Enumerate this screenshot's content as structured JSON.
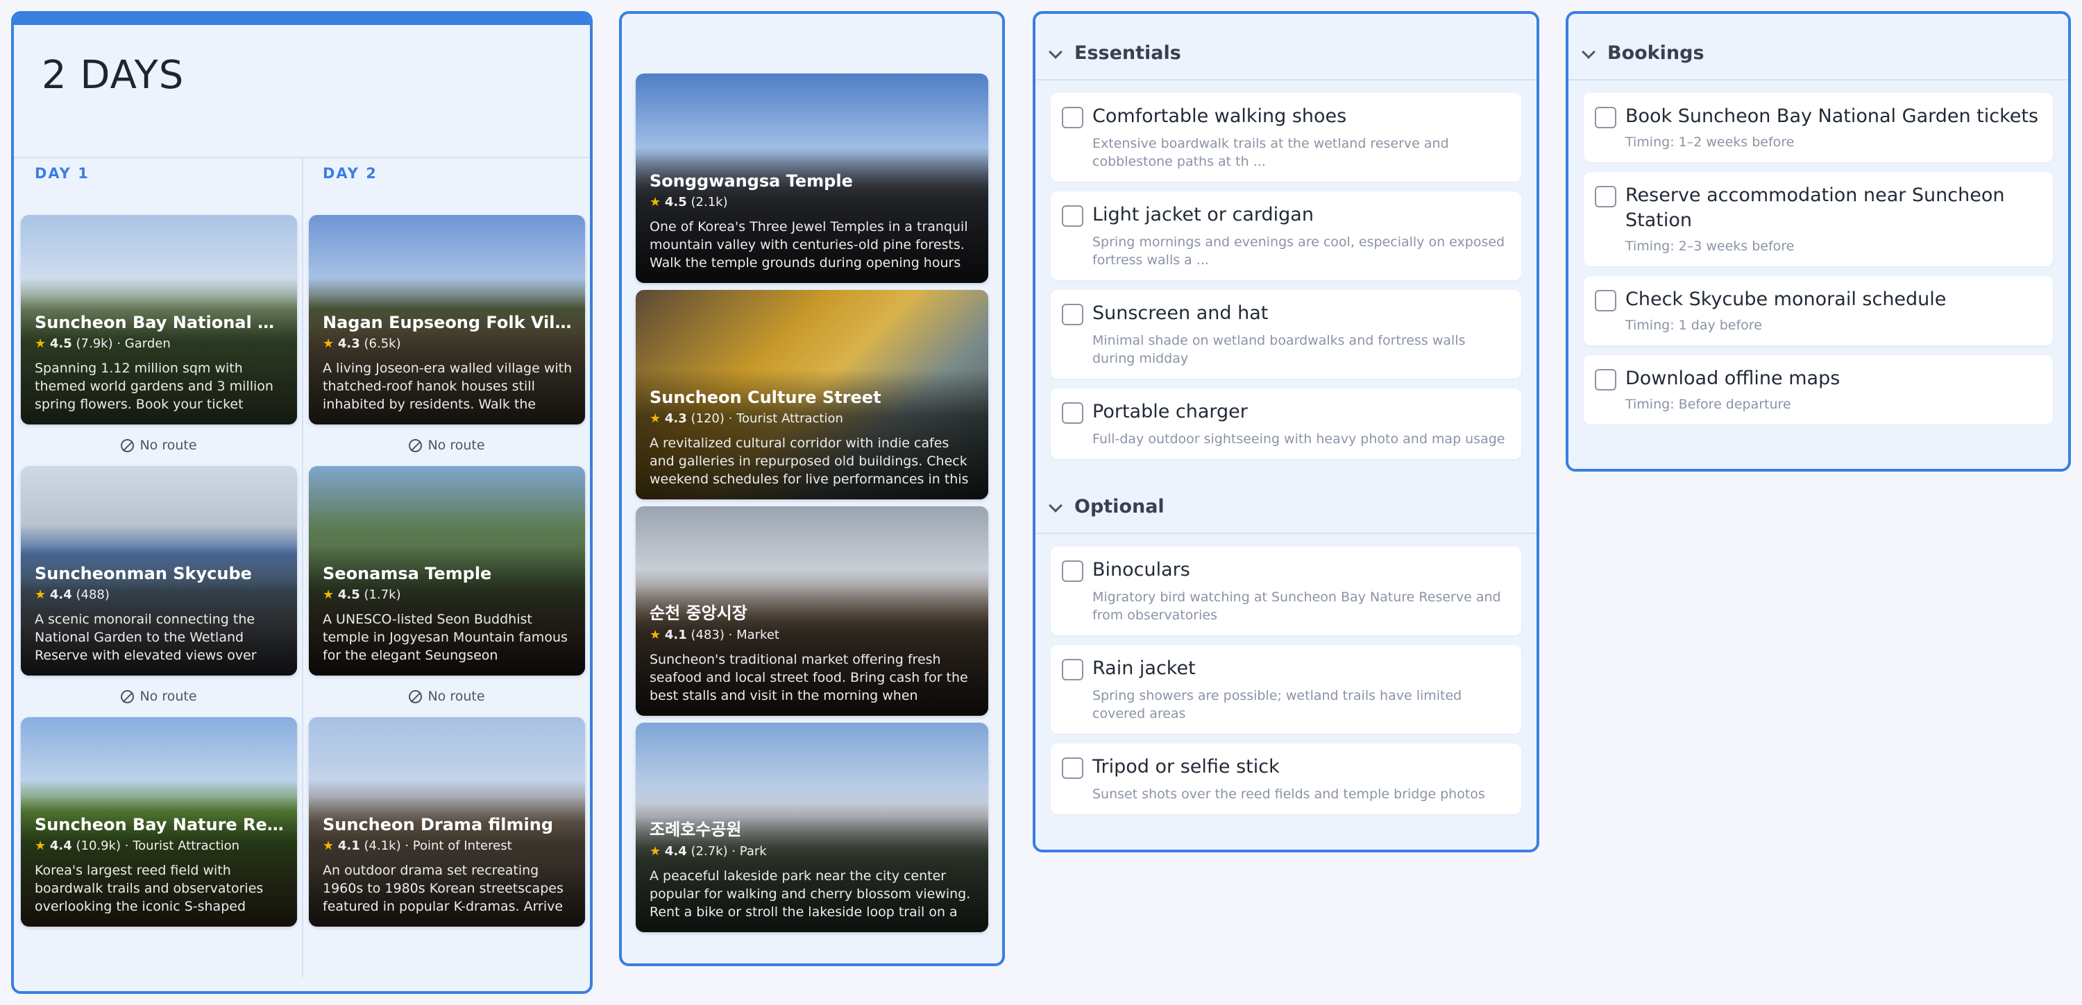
{
  "days_panel": {
    "title": "2 DAYS",
    "day1": {
      "label": "DAY 1",
      "cards": [
        {
          "name": "Suncheon Bay National Garden",
          "rating": "4.5",
          "reviews": "(7.9k)",
          "category": "Garden",
          "desc": "Spanning 1.12 million sqm with themed world gardens and 3 million spring flowers. Book your ticket"
        },
        {
          "name": "Suncheonman Skycube",
          "rating": "4.4",
          "reviews": "(488)",
          "category": "",
          "desc": "A scenic monorail connecting the National Garden to the Wetland Reserve with elevated views over"
        },
        {
          "name": "Suncheon Bay Nature Reserve",
          "rating": "4.4",
          "reviews": "(10.9k)",
          "category": "Tourist Attraction",
          "desc": "Korea's largest reed field with boardwalk trails and observatories overlooking the iconic S-shaped"
        }
      ],
      "routes": [
        "No route",
        "No route"
      ]
    },
    "day2": {
      "label": "DAY 2",
      "cards": [
        {
          "name": "Nagan Eupseong Folk Village",
          "rating": "4.3",
          "reviews": "(6.5k)",
          "category": "",
          "desc": "A living Joseon-era walled village with thatched-roof hanok houses still inhabited by residents. Walk the"
        },
        {
          "name": "Seonamsa Temple",
          "rating": "4.5",
          "reviews": "(1.7k)",
          "category": "",
          "desc": "A UNESCO-listed Seon Buddhist temple in Jogyesan Mountain famous for the elegant Seungseon"
        },
        {
          "name": "Suncheon Drama filming",
          "rating": "4.1",
          "reviews": "(4.1k)",
          "category": "Point of Interest",
          "desc": "An outdoor drama set recreating 1960s to 1980s Korean streetscapes featured in popular K-dramas. Arrive"
        }
      ],
      "routes": [
        "No route",
        "No route"
      ]
    }
  },
  "suggestions": [
    {
      "name": "Songgwangsa Temple",
      "rating": "4.5",
      "reviews": "(2.1k)",
      "category": "",
      "desc": "One of Korea's Three Jewel Temples in a tranquil mountain valley with centuries-old pine forests. Walk the temple grounds during opening hours"
    },
    {
      "name": "Suncheon Culture Street",
      "rating": "4.3",
      "reviews": "(120)",
      "category": "Tourist Attraction",
      "desc": "A revitalized cultural corridor with indie cafes and galleries in repurposed old buildings. Check weekend schedules for live performances in this"
    },
    {
      "name": "순천 중앙시장",
      "rating": "4.1",
      "reviews": "(483)",
      "category": "Market",
      "desc": "Suncheon's traditional market offering fresh seafood and local street food. Bring cash for the best stalls and visit in the morning when vendors"
    },
    {
      "name": "조례호수공원",
      "rating": "4.4",
      "reviews": "(2.7k)",
      "category": "Park",
      "desc": "A peaceful lakeside park near the city center popular for walking and cherry blossom viewing. Rent a bike or stroll the lakeside loop trail on a"
    }
  ],
  "essentials": {
    "label": "Essentials",
    "items": [
      {
        "title": "Comfortable walking shoes",
        "sub": "Extensive boardwalk trails at the wetland reserve and cobblestone paths at th ..."
      },
      {
        "title": "Light jacket or cardigan",
        "sub": "Spring mornings and evenings are cool, especially on exposed fortress walls a ..."
      },
      {
        "title": "Sunscreen and hat",
        "sub": "Minimal shade on wetland boardwalks and fortress walls during midday"
      },
      {
        "title": "Portable charger",
        "sub": "Full-day outdoor sightseeing with heavy photo and map usage"
      }
    ]
  },
  "optional": {
    "label": "Optional",
    "items": [
      {
        "title": "Binoculars",
        "sub": "Migratory bird watching at Suncheon Bay Nature Reserve and from observatories"
      },
      {
        "title": "Rain jacket",
        "sub": "Spring showers are possible; wetland trails have limited covered areas"
      },
      {
        "title": "Tripod or selfie stick",
        "sub": "Sunset shots over the reed fields and temple bridge photos"
      }
    ]
  },
  "bookings": {
    "label": "Bookings",
    "items": [
      {
        "title": "Book Suncheon Bay National Garden tickets",
        "sub": "Timing: 1–2 weeks before"
      },
      {
        "title": "Reserve accommodation near Suncheon Station",
        "sub": "Timing: 2–3 weeks before"
      },
      {
        "title": "Check Skycube monorail schedule",
        "sub": "Timing: 1 day before"
      },
      {
        "title": "Download offline maps",
        "sub": "Timing: Before departure"
      }
    ]
  },
  "colors": {
    "accent": "#3a7fe0",
    "star": "#f4b400",
    "panel_bg": "#edf3fd"
  },
  "icons": {
    "chevron": "chevron-down-icon",
    "route": "no-route-icon",
    "star": "star-icon",
    "checkbox": "checkbox-icon"
  }
}
